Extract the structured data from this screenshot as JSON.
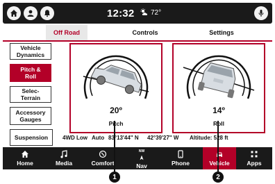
{
  "status": {
    "time": "12:32",
    "temperature": "72°",
    "icons": [
      "home-icon",
      "user-icon",
      "bell-icon",
      "microphone-icon"
    ]
  },
  "tabs": [
    {
      "label": "Off Road",
      "active": true
    },
    {
      "label": "Controls",
      "active": false
    },
    {
      "label": "Settings",
      "active": false
    }
  ],
  "sidebar": {
    "items": [
      {
        "label": "Vehicle Dynamics",
        "active": false
      },
      {
        "label": "Pitch & Roll",
        "active": true
      },
      {
        "label": "Selec-Terrain",
        "active": false
      },
      {
        "label": "Accessory Gauges",
        "active": false
      },
      {
        "label": "Suspension",
        "active": false
      }
    ]
  },
  "gauges": {
    "pitch": {
      "label": "Pitch",
      "angle": "20º",
      "angle_value": 20
    },
    "roll": {
      "label": "Roll",
      "angle": "14º",
      "angle_value": 14
    }
  },
  "info": {
    "drive_mode": "4WD Low",
    "transfer": "Auto",
    "latitude": "83°13'44\" N",
    "longitude": "42°39'27\" W",
    "altitude": "Altitude: 528 ft"
  },
  "nav": {
    "items": [
      {
        "label": "Home",
        "icon": "home-icon",
        "active": false,
        "sub": ""
      },
      {
        "label": "Media",
        "icon": "music-icon",
        "active": false,
        "sub": ""
      },
      {
        "label": "Comfort",
        "icon": "comfort-icon",
        "active": false,
        "sub": ""
      },
      {
        "label": "Nav",
        "icon": "compass-icon",
        "active": false,
        "sub": "NW"
      },
      {
        "label": "Phone",
        "icon": "phone-icon",
        "active": false,
        "sub": ""
      },
      {
        "label": "Vehicle",
        "icon": "car-icon",
        "active": true,
        "sub": ""
      },
      {
        "label": "Apps",
        "icon": "apps-icon",
        "active": false,
        "sub": ""
      }
    ]
  },
  "callouts": [
    "1",
    "2"
  ],
  "colors": {
    "accent": "#b30028",
    "bar": "#1a1a1a"
  }
}
